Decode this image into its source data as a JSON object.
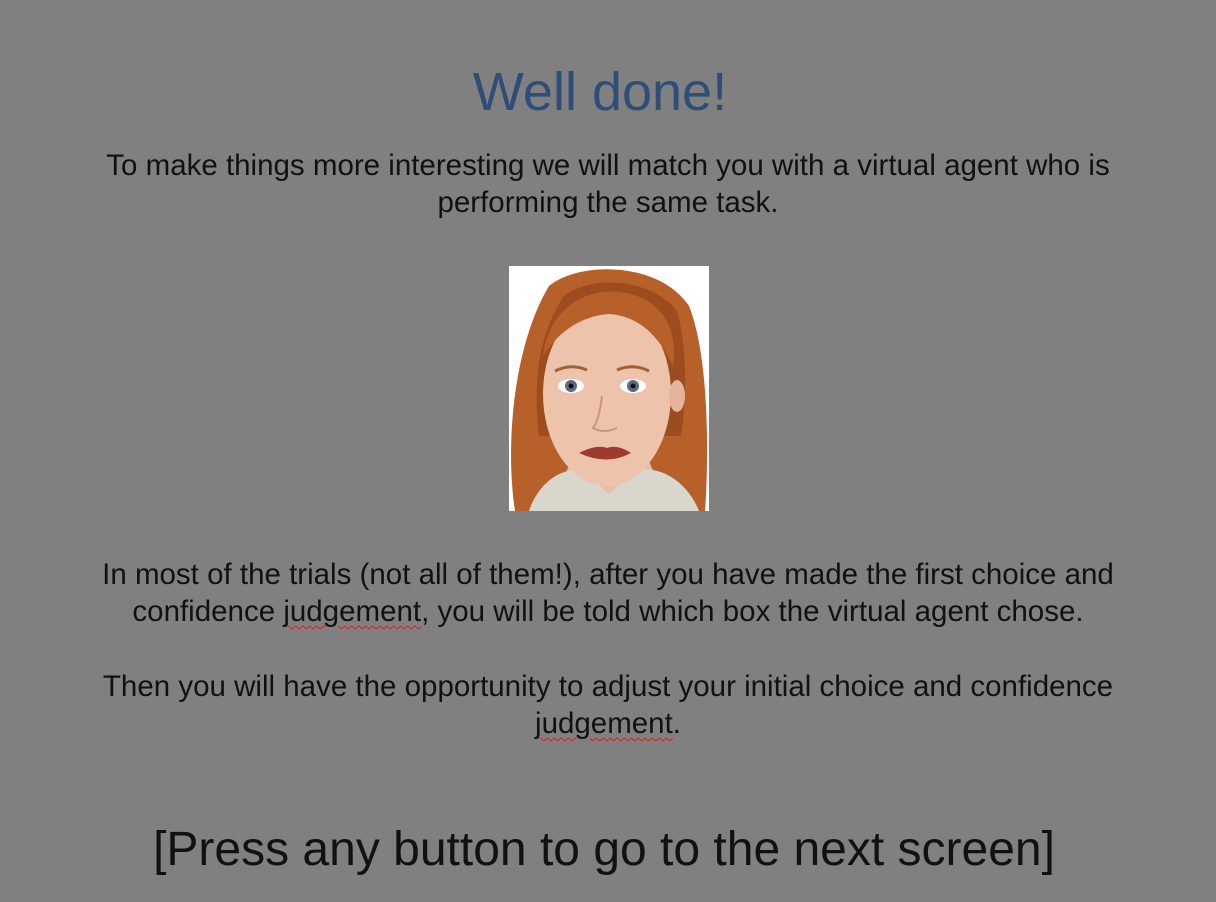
{
  "heading": "Well done!",
  "intro": {
    "line1": "To make things more interesting we will match you with a virtual agent who is",
    "line2": "performing the same task."
  },
  "agent_image": {
    "alt": "virtual agent face photo",
    "hair_color": "#b8602a",
    "skin_color": "#eec3ac",
    "background": "#ffffff"
  },
  "info": {
    "line1": "In most of the trials (not all of them!), after you have made the first choice and",
    "line2_before": "confidence ",
    "line2_word": "judgement",
    "line2_after": ", you will be told which box the virtual agent chose."
  },
  "adjust": {
    "line1": "Then you will have the opportunity to adjust your initial choice and confidence",
    "line2_word": "judgement",
    "line2_after": "."
  },
  "prompt": "[Press any button to go to the next screen]",
  "colors": {
    "background": "#808080",
    "heading": "#2e4e78",
    "text": "#111111",
    "spellcheck": "#cc2020"
  }
}
